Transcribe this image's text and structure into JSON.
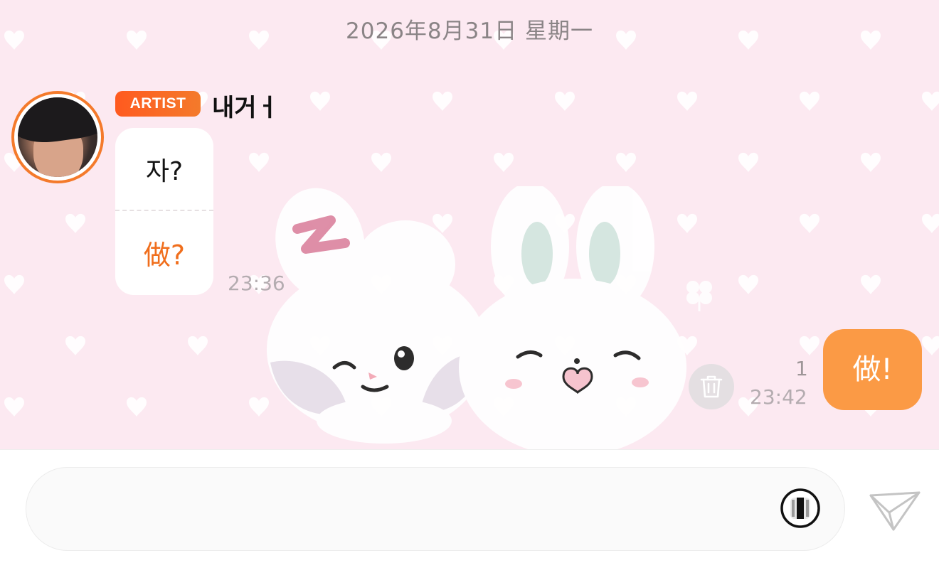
{
  "chat": {
    "date_divider": "2026年8月31日 星期一",
    "artist_message": {
      "badge": "ARTIST",
      "sender_name": "내거ㅓ",
      "original_text": "자?",
      "translated_text": "做?",
      "time": "23:36"
    },
    "my_message": {
      "text": "做!",
      "unread_count": "1",
      "time": "23:42"
    }
  },
  "input": {
    "value": "",
    "placeholder": ""
  },
  "icons": {
    "delete": "trash-icon",
    "translate": "translate-toggle-icon",
    "send": "paper-plane-icon"
  },
  "colors": {
    "accent": "#f47a2b",
    "my_bubble": "#fb9a45",
    "background": "#fce9f1"
  }
}
